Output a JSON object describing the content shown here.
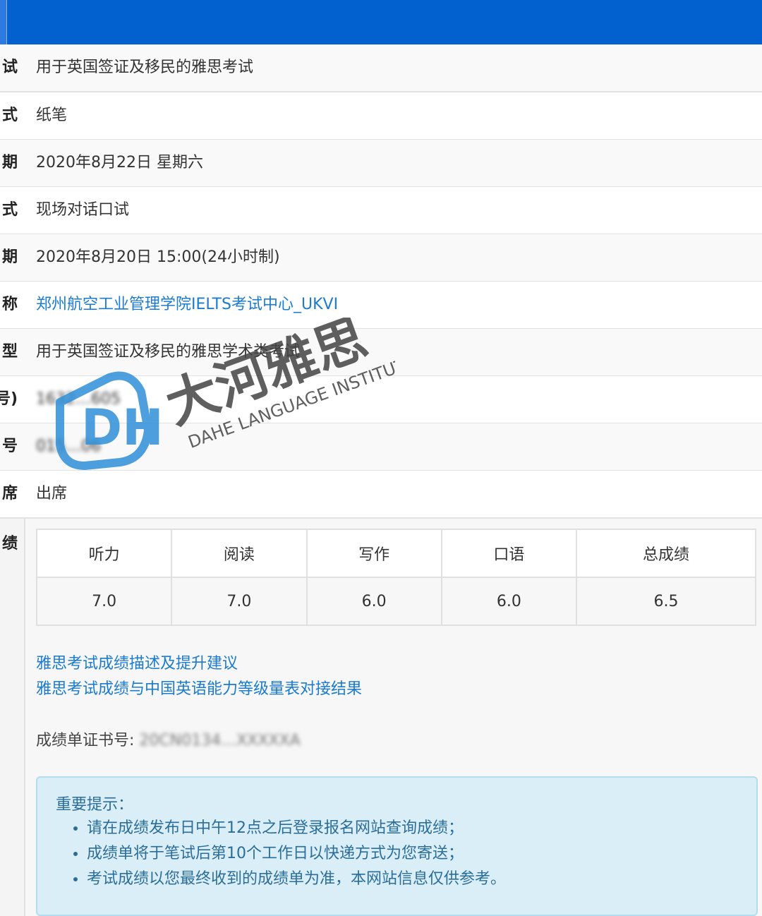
{
  "rows": [
    {
      "label": "试",
      "value": "用于英国签证及移民的雅思考试"
    },
    {
      "label": "式",
      "value": "纸笔"
    },
    {
      "label": "期",
      "value": "2020年8月22日 星期六"
    },
    {
      "label": "式",
      "value": "现场对话口试"
    },
    {
      "label": "期",
      "value": "2020年8月20日 15:00(24小时制)"
    },
    {
      "label": "称",
      "value": "郑州航空工业管理学院IELTS考试中心_UKVI"
    },
    {
      "label": "型",
      "value": "用于英国签证及移民的雅思学术类考试"
    },
    {
      "label": "号)",
      "value": "1632…605"
    },
    {
      "label": "号",
      "value": "015…06"
    },
    {
      "label": "席",
      "value": "出席"
    }
  ],
  "scores": {
    "label": "绩",
    "headers": [
      "听力",
      "阅读",
      "写作",
      "口语",
      "总成绩"
    ],
    "values": [
      "7.0",
      "7.0",
      "6.0",
      "6.0",
      "6.5"
    ]
  },
  "links": {
    "describe": "雅思考试成绩描述及提升建议",
    "cse": "雅思考试成绩与中国英语能力等级量表对接结果"
  },
  "certificate": {
    "label": "成绩单证书号: ",
    "value": "20CN0134…XXXXXA"
  },
  "notice": {
    "title": "重要提示：",
    "items": [
      "请在成绩发布日中午12点之后登录报名网站查询成绩；",
      "成绩单将于笔试后第10个工作日以快递方式为您寄送；",
      "考试成绩以您最终收到的成绩单为准，本网站信息仅供参考。"
    ]
  },
  "watermark": {
    "brand_cn": "大河雅思",
    "brand_en": "DAHE LANGUAGE INSTITUTE",
    "logo_letters": "DH"
  },
  "colors": {
    "header_blue": "#0361cf",
    "link_blue": "#1a7bd0",
    "notice_bg": "#daeef8",
    "notice_text": "#2b6d9a"
  }
}
